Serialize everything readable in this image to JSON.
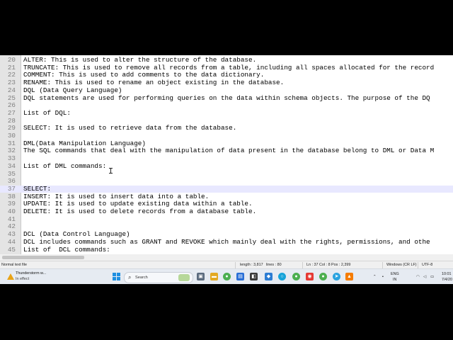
{
  "editor": {
    "lines": [
      {
        "num": "20",
        "text": "ALTER: This is used to alter the structure of the database."
      },
      {
        "num": "21",
        "text": "TRUNCATE: This is used to remove all records from a table, including all spaces allocated for the record"
      },
      {
        "num": "22",
        "text": "COMMENT: This is used to add comments to the data dictionary."
      },
      {
        "num": "23",
        "text": "RENAME: This is used to rename an object existing in the database."
      },
      {
        "num": "24",
        "text": "DQL (Data Query Language)"
      },
      {
        "num": "25",
        "text": "DQL statements are used for performing queries on the data within schema objects. The purpose of the DQ"
      },
      {
        "num": "26",
        "text": ""
      },
      {
        "num": "27",
        "text": "List of DQL:"
      },
      {
        "num": "28",
        "text": ""
      },
      {
        "num": "29",
        "text": "SELECT: It is used to retrieve data from the database."
      },
      {
        "num": "30",
        "text": ""
      },
      {
        "num": "31",
        "text": "DML(Data Manipulation Language)"
      },
      {
        "num": "32",
        "text": "The SQL commands that deal with the manipulation of data present in the database belong to DML or Data M"
      },
      {
        "num": "33",
        "text": ""
      },
      {
        "num": "34",
        "text": "List of DML commands:"
      },
      {
        "num": "35",
        "text": ""
      },
      {
        "num": "36",
        "text": ""
      },
      {
        "num": "37",
        "text": "SELECT:"
      },
      {
        "num": "38",
        "text": "INSERT: It is used to insert data into a table."
      },
      {
        "num": "39",
        "text": "UPDATE: It is used to update existing data within a table."
      },
      {
        "num": "40",
        "text": "DELETE: It is used to delete records from a database table."
      },
      {
        "num": "41",
        "text": ""
      },
      {
        "num": "42",
        "text": ""
      },
      {
        "num": "43",
        "text": "DCL (Data Control Language)"
      },
      {
        "num": "44",
        "text": "DCL includes commands such as GRANT and REVOKE which mainly deal with the rights, permissions, and othe"
      },
      {
        "num": "45",
        "text": "List of  DCL commands:"
      }
    ],
    "current_line_index": 17
  },
  "statusbar": {
    "file_type": "Normal text file",
    "length": "length : 3,817",
    "lines": "lines : 80",
    "position": "Ln : 37    Col : 8    Pos : 2,399",
    "eol": "Windows (CR LF)",
    "encoding": "UTF-8"
  },
  "taskbar": {
    "weather_title": "Thunderstorm w...",
    "weather_sub": "In effect",
    "search_label": "Search",
    "language": "ENG",
    "region": "IN",
    "time": "10:01",
    "date": "7/4/20"
  },
  "colors": {
    "gutter": "#e4e4e4",
    "current_line": "#e8e8ff",
    "taskbar": "#e6ebf2",
    "accent_blue": "#1e8fe1"
  },
  "icons": [
    "start-icon",
    "search-icon",
    "task-view-icon",
    "chat-icon",
    "file-explorer-icon",
    "chrome-icon",
    "edge-icon",
    "store-icon",
    "app-icon",
    "telegram-icon",
    "vlc-icon",
    "chevron-up-icon",
    "wifi-icon",
    "speaker-icon",
    "battery-icon"
  ]
}
